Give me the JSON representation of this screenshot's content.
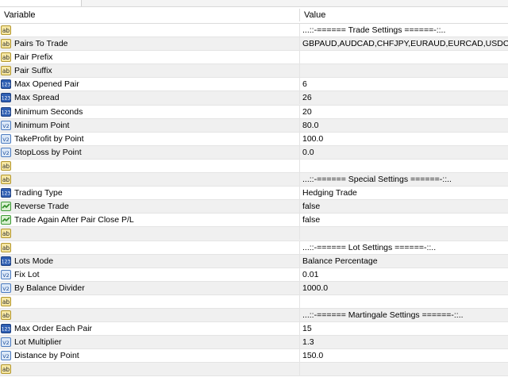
{
  "header": {
    "variable_label": "Variable",
    "value_label": "Value"
  },
  "icons": {
    "ab": "text-param-icon",
    "123": "integer-param-icon",
    "v2": "double-param-icon",
    "bool": "boolean-param-icon"
  },
  "params": [
    {
      "icon": "ab",
      "name": "",
      "value": "...::-====== Trade Settings ======-::.."
    },
    {
      "icon": "ab",
      "name": "Pairs To Trade",
      "value": "GBPAUD,AUDCAD,CHFJPY,EURAUD,EURCAD,USDCHF,GBP"
    },
    {
      "icon": "ab",
      "name": "Pair Prefix",
      "value": ""
    },
    {
      "icon": "ab",
      "name": "Pair Suffix",
      "value": ""
    },
    {
      "icon": "123",
      "name": "Max Opened Pair",
      "value": "6"
    },
    {
      "icon": "123",
      "name": "Max Spread",
      "value": "26"
    },
    {
      "icon": "123",
      "name": "Minimum Seconds",
      "value": "20"
    },
    {
      "icon": "v2",
      "name": "Minimum Point",
      "value": "80.0"
    },
    {
      "icon": "v2",
      "name": "TakeProfit by Point",
      "value": "100.0"
    },
    {
      "icon": "v2",
      "name": "StopLoss by Point",
      "value": "0.0"
    },
    {
      "icon": "ab",
      "name": "",
      "value": ""
    },
    {
      "icon": "ab",
      "name": "",
      "value": "...::-====== Special Settings ======-::.."
    },
    {
      "icon": "123",
      "name": "Trading Type",
      "value": "Hedging Trade"
    },
    {
      "icon": "bool",
      "name": "Reverse Trade",
      "value": "false"
    },
    {
      "icon": "bool",
      "name": "Trade Again After Pair Close P/L",
      "value": "false"
    },
    {
      "icon": "ab",
      "name": "",
      "value": ""
    },
    {
      "icon": "ab",
      "name": "",
      "value": "...::-====== Lot Settings ======-::.."
    },
    {
      "icon": "123",
      "name": "Lots Mode",
      "value": "Balance Percentage"
    },
    {
      "icon": "v2",
      "name": "Fix Lot",
      "value": "0.01"
    },
    {
      "icon": "v2",
      "name": "By Balance Divider",
      "value": "1000.0"
    },
    {
      "icon": "ab",
      "name": "",
      "value": ""
    },
    {
      "icon": "ab",
      "name": "",
      "value": "...::-====== Martingale Settings ======-::.."
    },
    {
      "icon": "123",
      "name": "Max Order Each Pair",
      "value": "15"
    },
    {
      "icon": "v2",
      "name": "Lot Multiplier",
      "value": "1.3"
    },
    {
      "icon": "v2",
      "name": "Distance by Point",
      "value": "150.0"
    },
    {
      "icon": "ab",
      "name": "",
      "value": ""
    }
  ]
}
